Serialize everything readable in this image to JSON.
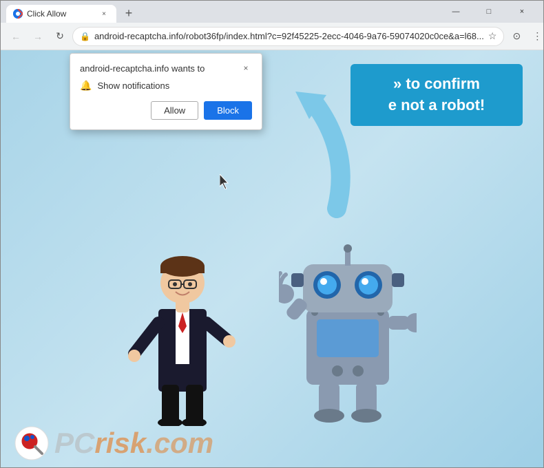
{
  "browser": {
    "tab": {
      "favicon": "C",
      "title": "Click Allow",
      "close": "×"
    },
    "new_tab": "+",
    "window_controls": {
      "minimize": "—",
      "maximize": "□",
      "close": "×"
    },
    "address_bar": {
      "back": "←",
      "forward": "→",
      "refresh": "↻",
      "url": "android-recaptcha.info/robot36fp/index.html?c=92f45225-2ecc-4046-9a76-59074020c0ce&a=l68...",
      "star": "☆",
      "account": "⊙",
      "menu": "⋮"
    }
  },
  "popup": {
    "title": "android-recaptcha.info wants to",
    "close": "×",
    "notification_icon": "🔔",
    "notification_label": "Show notifications",
    "allow_label": "Allow",
    "block_label": "Block"
  },
  "banner": {
    "line1": "» to confirm",
    "line2": "e not a robot!"
  },
  "watermark": {
    "pc": "PC",
    "risk": "risk",
    "dot_com": ".com"
  }
}
